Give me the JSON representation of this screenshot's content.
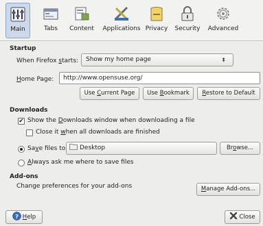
{
  "toolbar": {
    "tabs": [
      {
        "label": "Main",
        "icon": "main-prefs-icon"
      },
      {
        "label": "Tabs",
        "icon": "tabs-icon"
      },
      {
        "label": "Content",
        "icon": "content-icon"
      },
      {
        "label": "Applications",
        "icon": "applications-icon"
      },
      {
        "label": "Privacy",
        "icon": "privacy-icon"
      },
      {
        "label": "Security",
        "icon": "lock-icon"
      },
      {
        "label": "Advanced",
        "icon": "gear-icon"
      }
    ],
    "active_tab": "Main"
  },
  "startup": {
    "title": "Startup",
    "when_label_pre": "When Firefox ",
    "when_label_ul": "s",
    "when_label_post": "tarts:",
    "when_value": "Show my home page",
    "home_label_ul": "H",
    "home_label_post": "ome Page:",
    "home_value": "http://www.opensuse.org/",
    "btn_current_pre": "Use ",
    "btn_current_ul": "C",
    "btn_current_post": "urrent Page",
    "btn_bookmark_pre": "Use ",
    "btn_bookmark_ul": "B",
    "btn_bookmark_post": "ookmark",
    "btn_restore_ul": "R",
    "btn_restore_post": "estore to Default"
  },
  "downloads": {
    "title": "Downloads",
    "show_pre": "Show the ",
    "show_ul": "D",
    "show_post": "ownloads window when downloading a file",
    "show_checked": true,
    "close_pre": "Close it ",
    "close_ul": "w",
    "close_post": "hen all downloads are finished",
    "close_checked": false,
    "save_pre": "Sa",
    "save_ul": "v",
    "save_post": "e files to",
    "save_selected": true,
    "save_folder": "Desktop",
    "browse_pre": "Br",
    "browse_ul": "o",
    "browse_post": "wse...",
    "ask_ul": "A",
    "ask_post": "lways ask me where to save files",
    "ask_selected": false
  },
  "addons": {
    "title": "Add-ons",
    "desc": "Change preferences for your add-ons",
    "btn_pre": "",
    "btn_ul": "M",
    "btn_post": "anage Add-ons..."
  },
  "footer": {
    "help_ul": "H",
    "help_post": "elp",
    "close_label": "Close"
  },
  "colors": {
    "background": "#ededec",
    "active_tab": "#cbd9ea"
  }
}
